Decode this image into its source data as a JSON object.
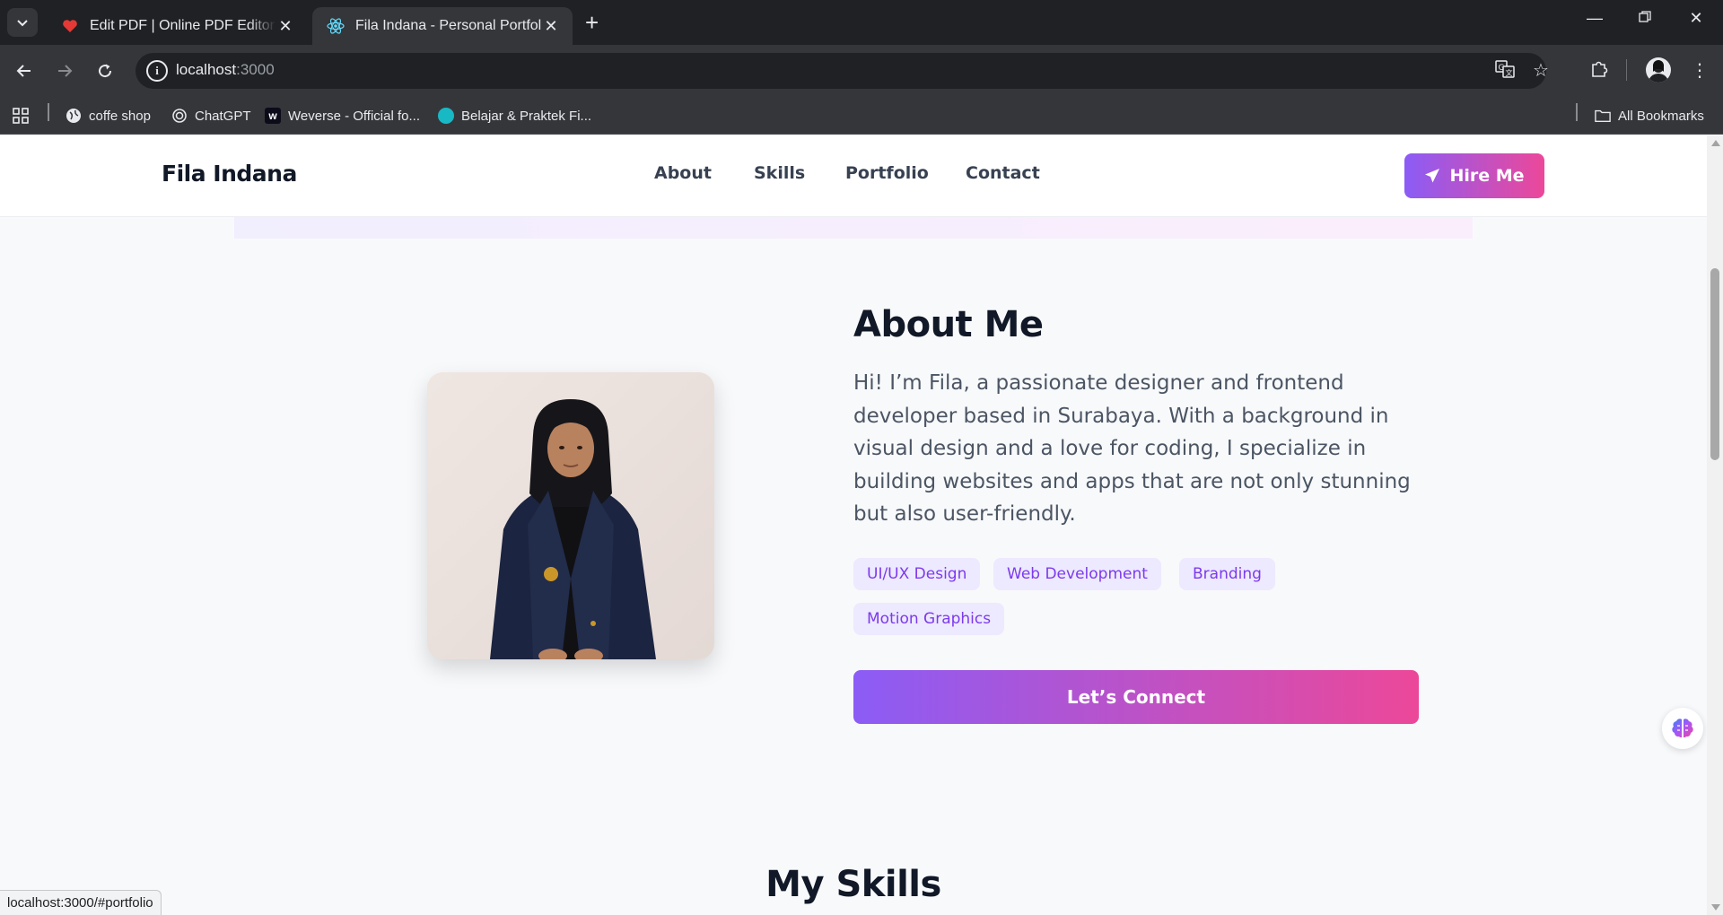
{
  "browser": {
    "tabs": [
      {
        "title": "Edit PDF | Online PDF Editor and Form Filler",
        "icon": "heart-pdf-icon",
        "active": false
      },
      {
        "title": "Fila Indana - Personal Portfolio",
        "icon": "react-icon",
        "active": true
      }
    ],
    "url_host": "localhost",
    "url_port": ":3000",
    "bookmarks": [
      {
        "label": "coffe shop",
        "icon": "globe-icon"
      },
      {
        "label": "ChatGPT",
        "icon": "chatgpt-icon"
      },
      {
        "label": "Weverse - Official fo...",
        "icon": "weverse-icon"
      },
      {
        "label": "Belajar & Praktek Fi...",
        "icon": "site-icon"
      }
    ],
    "all_bookmarks_label": "All Bookmarks",
    "status_url": "localhost:3000/#portfolio"
  },
  "site": {
    "brand": "Fila Indana",
    "nav": [
      "About",
      "Skills",
      "Portfolio",
      "Contact"
    ],
    "hire_label": "Hire Me"
  },
  "about": {
    "title": "About Me",
    "paragraph": "Hi! I’m Fila, a passionate designer and frontend developer based in Surabaya. With a background in visual design and a love for coding, I specialize in building websites and apps that are not only stunning but also user-friendly.",
    "tags": [
      "UI/UX Design",
      "Web Development",
      "Branding",
      "Motion Graphics"
    ],
    "cta_label": "Let’s Connect",
    "accent_start": "#8b5cf6",
    "accent_end": "#ec4899"
  },
  "skills": {
    "title": "My Skills"
  }
}
